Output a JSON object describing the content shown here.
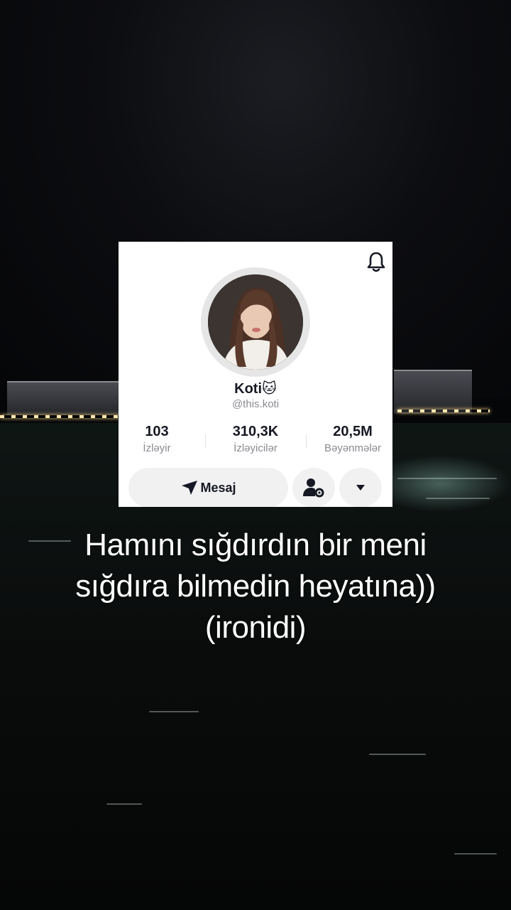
{
  "profile": {
    "name": "Koti",
    "name_emoji": "🐱",
    "username": "@this.koti"
  },
  "stats": [
    {
      "value": "103",
      "label": "İzləyir"
    },
    {
      "value": "310,3K",
      "label": "İzləyicilər"
    },
    {
      "value": "20,5M",
      "label": "Bəyənmələr"
    }
  ],
  "actions": {
    "message_label": "Mesaj"
  },
  "icons": [
    "bell-icon",
    "send-icon",
    "user-settings-icon",
    "caret-down-icon"
  ],
  "caption": {
    "line1": "Hamını sığdırdın bir meni",
    "line2": "sığdıra bilmedin heyatına))",
    "line3": "(ironidi)"
  },
  "colors": {
    "card_bg": "#ffffff",
    "button_bg": "#f1f1f2",
    "text_primary": "#161823",
    "text_secondary": "#8a8b91",
    "caption_text": "#ffffff"
  }
}
